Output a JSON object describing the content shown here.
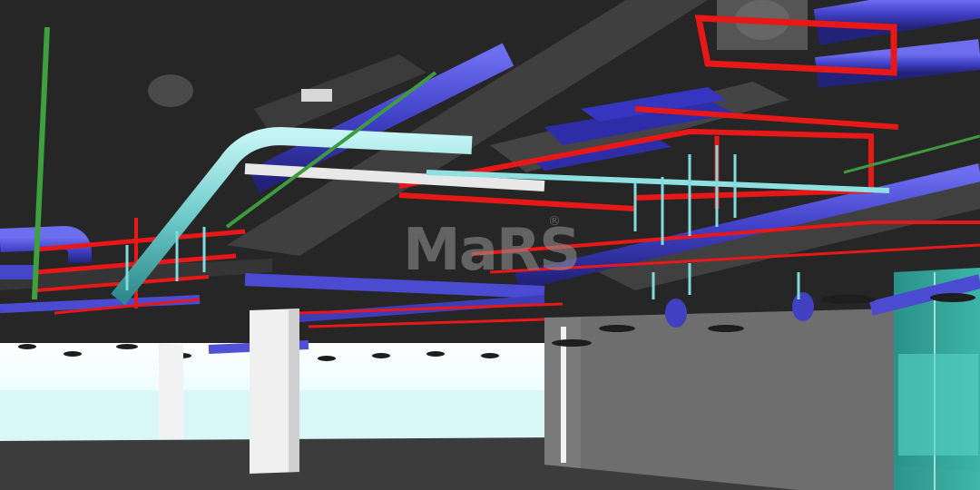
{
  "watermark": {
    "text": "MaRS",
    "registered_mark": "®"
  },
  "colors": {
    "background": "#262626",
    "concrete_ceiling": "#3a3a3a",
    "beam_grey": "#4a4a4a",
    "duct_blue": "#4b4bd2",
    "cable_tray_red": "#e81818",
    "pipe_cyan": "#7fd6d6",
    "pipe_white": "#e8e8e8",
    "pipe_green": "#3fa03f",
    "floor": "#3d3d3d",
    "glass": "#33b3a6",
    "bright_wall": "#f0fbfb"
  }
}
